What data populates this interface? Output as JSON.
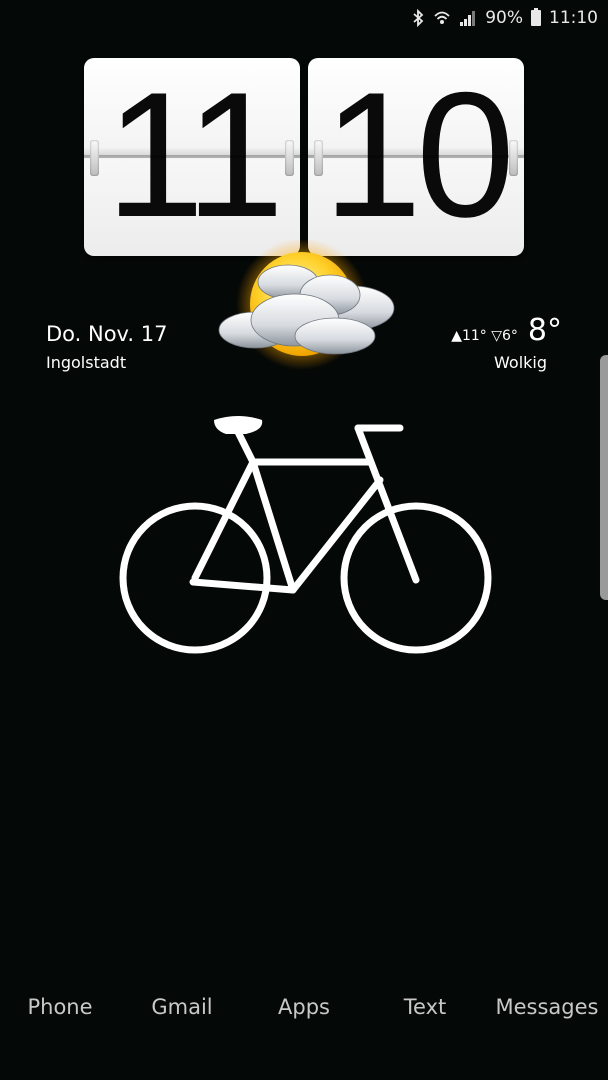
{
  "status_bar": {
    "battery_percent": "90%",
    "time": "11:10",
    "icons": [
      "bluetooth-icon",
      "wifi-icon",
      "signal-icon",
      "battery-icon"
    ]
  },
  "clock": {
    "hours": "11",
    "minutes": "10"
  },
  "weather": {
    "date": "Do. Nov. 17",
    "location": "Ingolstadt",
    "temp_range": "▲11° ▽6°",
    "current_temp": "8°",
    "condition": "Wolkig",
    "icon": "partly-cloudy-icon"
  },
  "wallpaper": {
    "icon": "bicycle-icon"
  },
  "dock": {
    "items": [
      {
        "label": "Phone"
      },
      {
        "label": "Gmail"
      },
      {
        "label": "Apps"
      },
      {
        "label": "Text"
      },
      {
        "label": "Messages"
      }
    ]
  },
  "colors": {
    "background": "#040806",
    "text": "#ffffff",
    "dock_text": "#c8c8c8"
  }
}
